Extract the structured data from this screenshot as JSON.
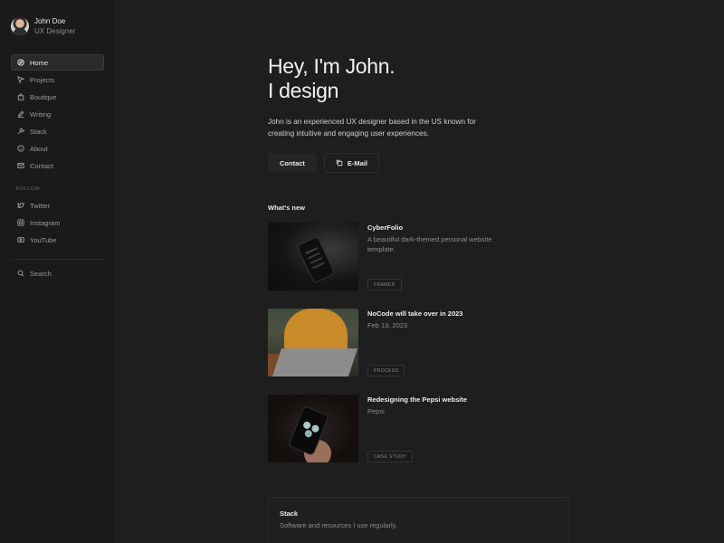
{
  "profile": {
    "name": "John Doe",
    "role": "UX Designer"
  },
  "nav": [
    {
      "label": "Home",
      "icon": "compass-icon",
      "active": true
    },
    {
      "label": "Projects",
      "icon": "cursor-icon"
    },
    {
      "label": "Boutique",
      "icon": "bag-icon"
    },
    {
      "label": "Writing",
      "icon": "pencil-icon"
    },
    {
      "label": "Stack",
      "icon": "wrench-icon"
    },
    {
      "label": "About",
      "icon": "info-icon"
    },
    {
      "label": "Contact",
      "icon": "mail-icon"
    }
  ],
  "follow": {
    "label": "FOLLOW",
    "items": [
      {
        "label": "Twitter",
        "icon": "twitter-icon"
      },
      {
        "label": "Instagram",
        "icon": "instagram-icon"
      },
      {
        "label": "YouTube",
        "icon": "youtube-icon"
      }
    ]
  },
  "search": {
    "label": "Search",
    "icon": "search-icon"
  },
  "hero": {
    "line1": "Hey, I'm John.",
    "line2": "I design",
    "intro": "John is an experienced UX designer based in the US known for creating intuitive and engaging user experiences."
  },
  "buttons": {
    "contact": "Contact",
    "email": "E-Mail"
  },
  "whats_new": {
    "heading": "What's new",
    "posts": [
      {
        "title": "CyberFolio",
        "subtitle": "A beautiful dark-themed personal website template.",
        "tag": "FRAMER"
      },
      {
        "title": "NoCode will take over in 2023",
        "subtitle": "Feb 13, 2023",
        "tag": "PROCESS"
      },
      {
        "title": "Redesigning the Pepsi website",
        "subtitle": "Pepsi",
        "tag": "CASE STUDY"
      }
    ]
  },
  "stack": {
    "title": "Stack",
    "subtitle": "Software and resources I use regularly."
  },
  "colors": {
    "background": "#1e1e1e",
    "sidebar": "#1a1a1a",
    "text": "#e8e8e8",
    "muted": "#8d8d8d"
  }
}
